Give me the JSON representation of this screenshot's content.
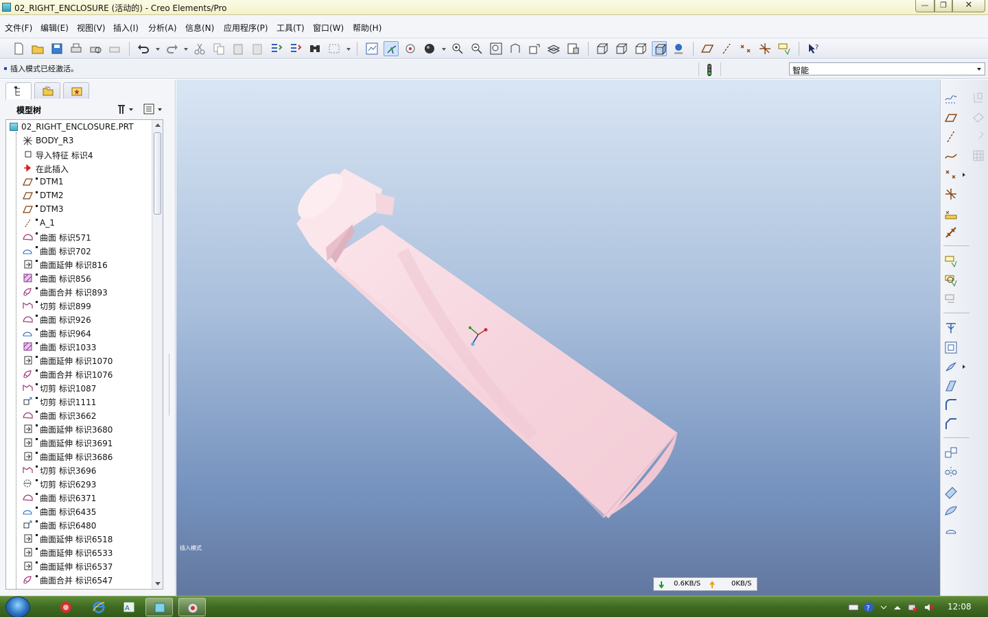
{
  "window": {
    "title": "02_RIGHT_ENCLOSURE (活动的) - Creo Elements/Pro",
    "minimize": "—",
    "maximize": "❐",
    "close": "✕"
  },
  "menu": [
    "文件(F)",
    "编辑(E)",
    "视图(V)",
    "插入(I)",
    "分析(A)",
    "信息(N)",
    "应用程序(P)",
    "工具(T)",
    "窗口(W)",
    "帮助(H)"
  ],
  "toolbar_icons": [
    "new-icon",
    "open-icon",
    "save-icon",
    "print-icon",
    "print-preview-icon",
    "quick-print-icon",
    "undo-icon",
    "redo-icon",
    "cut-icon",
    "copy-icon",
    "paste-icon",
    "paste-special-icon",
    "regenerate-icon",
    "regen-manager-icon",
    "find-icon",
    "select-box-icon",
    "repaint-icon",
    "spin-center-icon",
    "orient-mode-icon",
    "appearance-icon",
    "zoom-in-icon",
    "zoom-out-icon",
    "refit-icon",
    "reorient-icon",
    "saved-views-icon",
    "layers-icon",
    "view-manager-icon",
    "wireframe-icon",
    "hidden-line-icon",
    "no-hidden-icon",
    "shading-icon",
    "enhanced-realism-icon",
    "datum-planes-icon",
    "datum-axes-icon",
    "datum-points-icon",
    "coord-sys-icon",
    "annotations-icon",
    "whats-this-icon"
  ],
  "message": {
    "text": "插入模式已经激活。"
  },
  "filter": {
    "value": "智能"
  },
  "navigator": {
    "title": "模型树",
    "root": "02_RIGHT_ENCLOSURE.PRT",
    "items": [
      {
        "label": "BODY_R3",
        "icon": "csys-icon",
        "mark": false,
        "indent": 0
      },
      {
        "label": "导入特征 标识4",
        "icon": "import-feature-icon",
        "mark": false,
        "indent": 0
      },
      {
        "label": "在此插入",
        "icon": "insert-here-arrow-icon",
        "mark": false,
        "indent": 0
      },
      {
        "label": "DTM1",
        "icon": "datum-plane-icon",
        "mark": true,
        "indent": 0
      },
      {
        "label": "DTM2",
        "icon": "datum-plane-icon",
        "mark": true,
        "indent": 0
      },
      {
        "label": "DTM3",
        "icon": "datum-plane-icon",
        "mark": true,
        "indent": 0
      },
      {
        "label": "A_1",
        "icon": "datum-axis-icon",
        "mark": true,
        "indent": 0
      },
      {
        "label": "曲面 标识571",
        "icon": "boundary-surface-icon",
        "mark": true,
        "indent": 0
      },
      {
        "label": "曲面 标识702",
        "icon": "swept-surface-icon",
        "mark": true,
        "indent": 0
      },
      {
        "label": "曲面延伸 标识816",
        "icon": "extend-icon",
        "mark": true,
        "indent": 0
      },
      {
        "label": "曲面 标识856",
        "icon": "fill-surface-icon",
        "mark": true,
        "indent": 0
      },
      {
        "label": "曲面合并 标识893",
        "icon": "merge-icon",
        "mark": true,
        "indent": 0
      },
      {
        "label": "切剪 标识899",
        "icon": "cut-feature-icon",
        "mark": true,
        "indent": 0
      },
      {
        "label": "曲面 标识926",
        "icon": "boundary-surface-icon",
        "mark": true,
        "indent": 0
      },
      {
        "label": "曲面 标识964",
        "icon": "swept-surface-icon",
        "mark": true,
        "indent": 0
      },
      {
        "label": "曲面 标识1033",
        "icon": "fill-surface-icon",
        "mark": true,
        "indent": 0
      },
      {
        "label": "曲面延伸 标识1070",
        "icon": "extend-icon",
        "mark": true,
        "indent": 0
      },
      {
        "label": "曲面合并 标识1076",
        "icon": "merge-icon",
        "mark": true,
        "indent": 0
      },
      {
        "label": "切剪 标识1087",
        "icon": "cut-feature-icon",
        "mark": true,
        "indent": 0
      },
      {
        "label": "切剪 标识1111",
        "icon": "cut-extrude-icon",
        "mark": true,
        "indent": 0
      },
      {
        "label": "曲面 标识3662",
        "icon": "boundary-surface-icon",
        "mark": true,
        "indent": 0
      },
      {
        "label": "曲面延伸 标识3680",
        "icon": "extend-icon",
        "mark": true,
        "indent": 0
      },
      {
        "label": "曲面延伸 标识3691",
        "icon": "extend-icon",
        "mark": true,
        "indent": 0
      },
      {
        "label": "曲面延伸 标识3686",
        "icon": "extend-icon",
        "mark": true,
        "indent": 0
      },
      {
        "label": "切剪 标识3696",
        "icon": "cut-feature-icon",
        "mark": true,
        "indent": 0
      },
      {
        "label": "切剪 标识6293",
        "icon": "cut-revolve-icon",
        "mark": true,
        "indent": 0
      },
      {
        "label": "曲面 标识6371",
        "icon": "boundary-surface-icon",
        "mark": true,
        "indent": 0
      },
      {
        "label": "曲面 标识6435",
        "icon": "swept-surface-icon",
        "mark": true,
        "indent": 0
      },
      {
        "label": "曲面 标识6480",
        "icon": "cut-extrude-icon",
        "mark": true,
        "indent": 0
      },
      {
        "label": "曲面延伸 标识6518",
        "icon": "extend-icon",
        "mark": true,
        "indent": 0
      },
      {
        "label": "曲面延伸 标识6533",
        "icon": "extend-icon",
        "mark": true,
        "indent": 0
      },
      {
        "label": "曲面延伸 标识6537",
        "icon": "extend-icon",
        "mark": true,
        "indent": 0
      },
      {
        "label": "曲面合并 标识6547",
        "icon": "merge-icon",
        "mark": true,
        "indent": 0
      }
    ]
  },
  "graphics": {
    "mode_text": "插入模式",
    "download": "0.6KB/S",
    "upload": "0KB/S"
  },
  "right_toolbar_icons": [
    "sketch-icon",
    "plane-icon",
    "axis-icon",
    "curve-icon",
    "point-icon",
    "csys-tool-icon",
    "analysis-icon",
    "publish-geom-icon",
    "extrude-icon",
    "revolve-icon",
    "sweep-icon",
    "hole-icon",
    "shell-icon",
    "rib-icon",
    "draft-icon",
    "round-icon",
    "chamfer-icon",
    "pattern-icon",
    "mirror-icon",
    "trim-icon",
    "merge-tool-icon",
    "offset-icon"
  ],
  "taskbar": {
    "clock": "12:08"
  }
}
